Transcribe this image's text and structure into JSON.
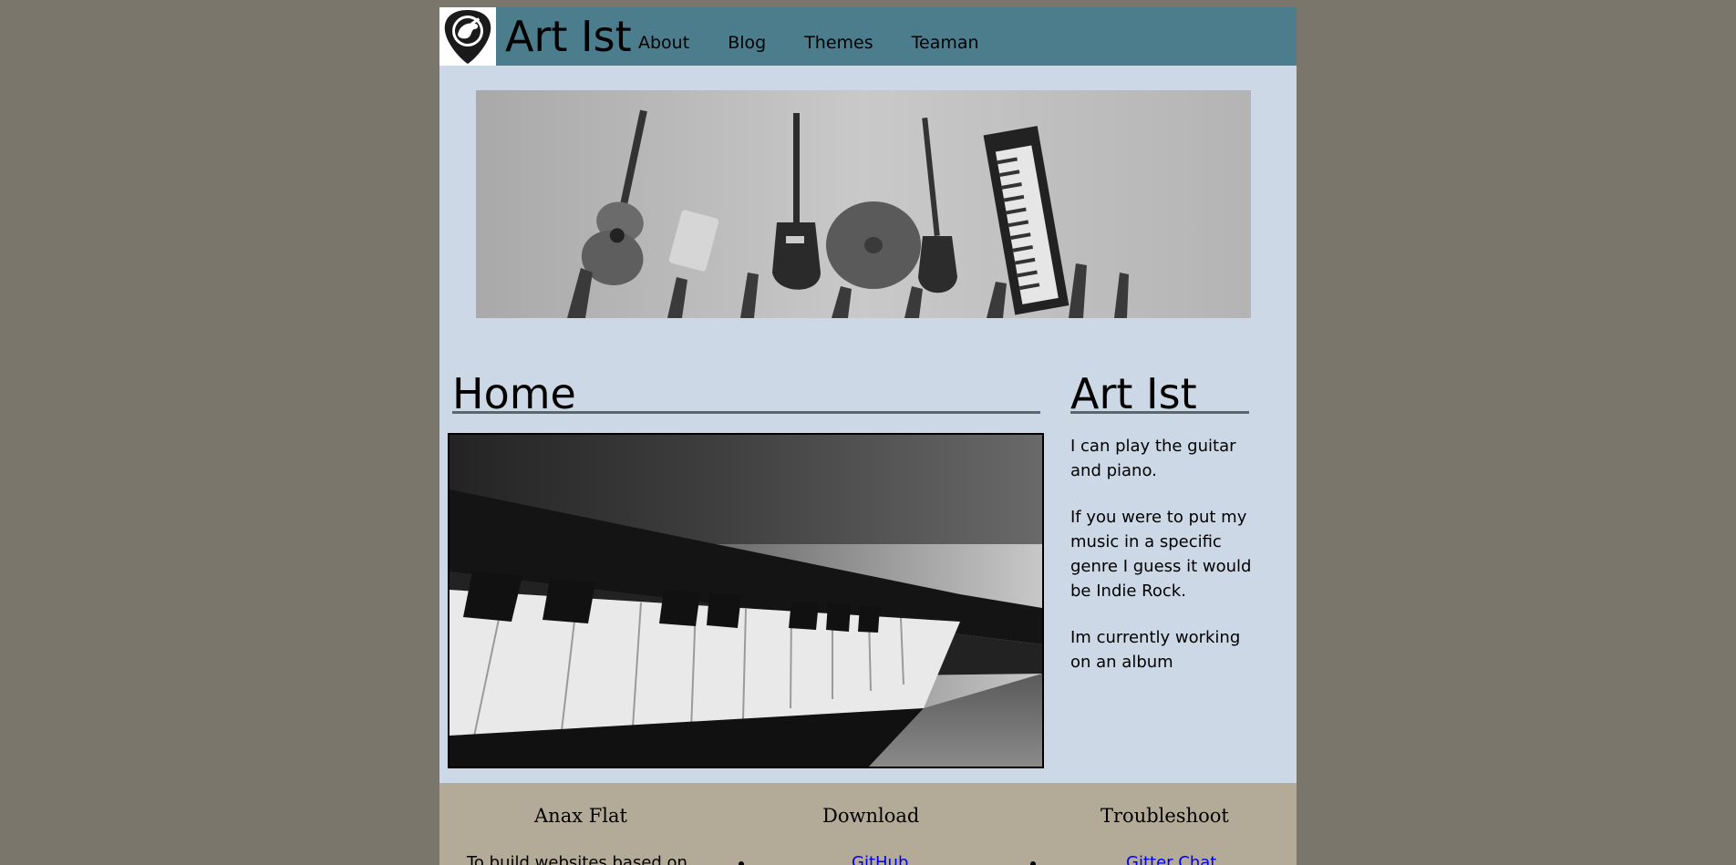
{
  "header": {
    "title": "Art Ist",
    "logo_icon": "guitar-pick-logo-icon",
    "nav": [
      "About",
      "Blog",
      "Themes",
      "Teaman"
    ]
  },
  "hero": {
    "image": "instruments-banner"
  },
  "main": {
    "title": "Home",
    "image": "piano-keys-photo"
  },
  "sidebar": {
    "title": "Art Ist",
    "paragraphs": [
      "I can play the guitar and piano.",
      "If you were to put my music in a specific genre I guess it would be Indie Rock.",
      "Im currently working on an album"
    ]
  },
  "footer": {
    "col1": {
      "title": "Anax Flat",
      "text": "To build websites based on"
    },
    "col2": {
      "title": "Download",
      "link": "GitHub"
    },
    "col3": {
      "title": "Troubleshoot",
      "link": "Gitter Chat"
    }
  },
  "colors": {
    "background": "#7a766b",
    "page": "#cdd8e6",
    "header": "#4b7d8c",
    "footer": "#b3aa98",
    "link": "#0000ee"
  }
}
